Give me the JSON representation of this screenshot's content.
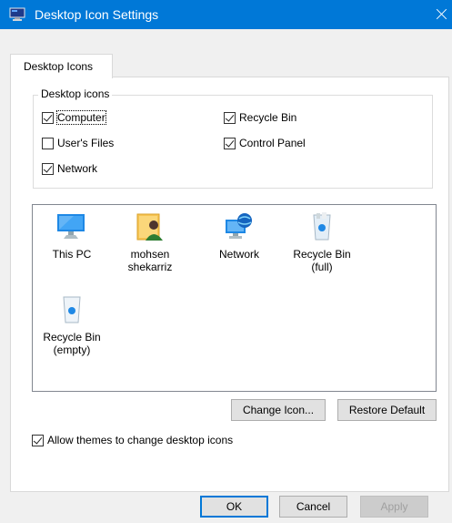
{
  "window": {
    "title": "Desktop Icon Settings"
  },
  "tabs": [
    {
      "label": "Desktop Icons"
    }
  ],
  "group": {
    "legend": "Desktop icons",
    "checkboxes": [
      {
        "label": "Computer",
        "checked": true
      },
      {
        "label": "User's Files",
        "checked": false
      },
      {
        "label": "Network",
        "checked": true
      },
      {
        "label": "Recycle Bin",
        "checked": true
      },
      {
        "label": "Control Panel",
        "checked": true
      }
    ]
  },
  "icons": [
    {
      "label": "This PC",
      "icon": "this-pc-icon"
    },
    {
      "label": "mohsen shekarriz",
      "icon": "user-folder-icon"
    },
    {
      "label": "Network",
      "icon": "network-icon"
    },
    {
      "label": "Recycle Bin (full)",
      "icon": "recycle-bin-full-icon"
    },
    {
      "label": "Recycle Bin (empty)",
      "icon": "recycle-bin-empty-icon"
    }
  ],
  "buttons": {
    "change_icon": "Change Icon...",
    "restore_default": "Restore Default",
    "ok": "OK",
    "cancel": "Cancel",
    "apply": "Apply"
  },
  "allow_themes": {
    "label": "Allow themes to change desktop icons",
    "checked": true
  },
  "colors": {
    "titlebar": "#0078d7",
    "frame": "#f0f0f0",
    "panel": "#ffffff"
  }
}
